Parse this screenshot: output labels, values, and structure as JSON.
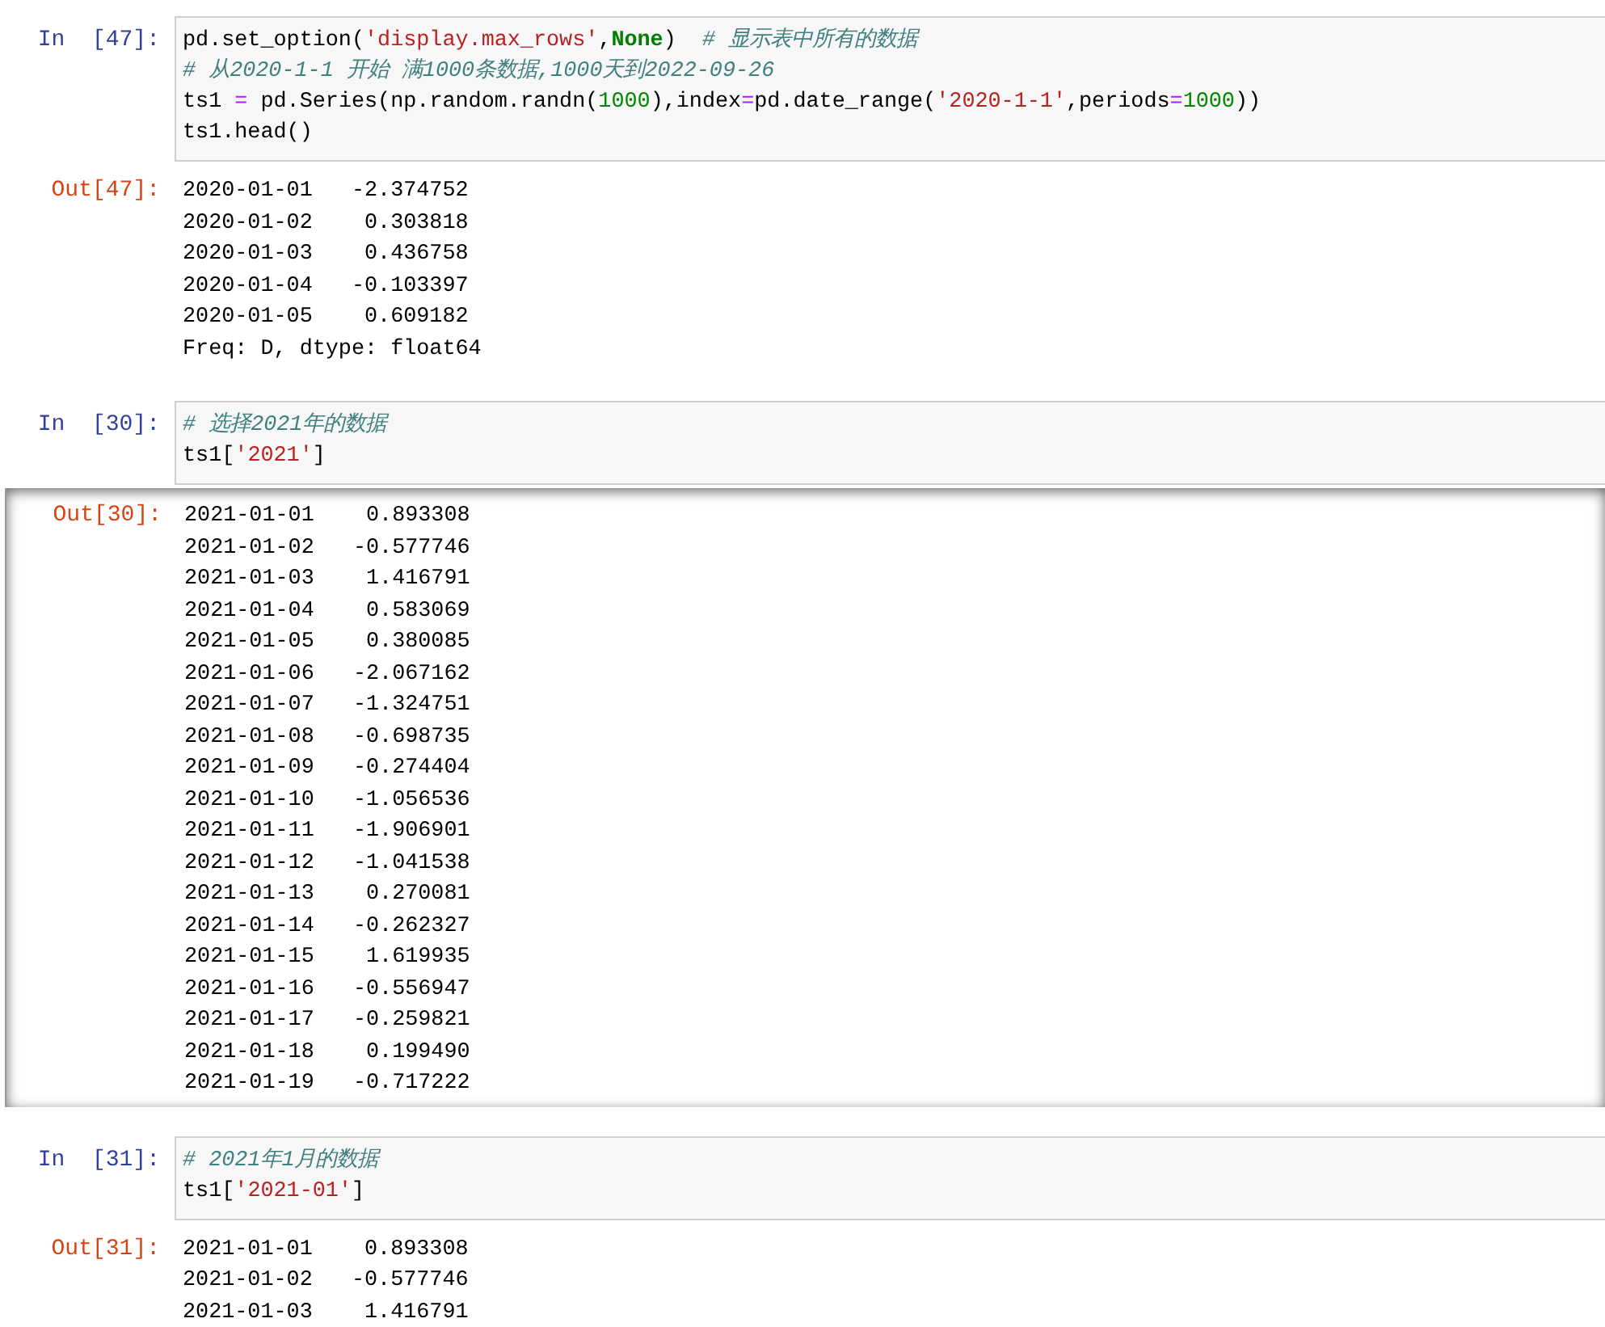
{
  "cells": [
    {
      "input": {
        "prompt": "In  [47]:",
        "lines": [
          [
            {
              "kind": "plain",
              "text": "pd.set_option("
            },
            {
              "kind": "string",
              "text": "'display.max_rows'"
            },
            {
              "kind": "plain",
              "text": ","
            },
            {
              "kind": "keyword",
              "text": "None"
            },
            {
              "kind": "plain",
              "text": ")  "
            },
            {
              "kind": "comment",
              "text": "# 显示表中所有的数据"
            }
          ],
          [
            {
              "kind": "comment",
              "text": "# 从2020-1-1 开始 满1000条数据,1000天到2022-09-26"
            }
          ],
          [
            {
              "kind": "plain",
              "text": "ts1 "
            },
            {
              "kind": "operator",
              "text": "="
            },
            {
              "kind": "plain",
              "text": " pd.Series(np.random.randn("
            },
            {
              "kind": "number",
              "text": "1000"
            },
            {
              "kind": "plain",
              "text": "),index"
            },
            {
              "kind": "operator",
              "text": "="
            },
            {
              "kind": "plain",
              "text": "pd.date_range("
            },
            {
              "kind": "string",
              "text": "'2020-1-1'"
            },
            {
              "kind": "plain",
              "text": ",periods"
            },
            {
              "kind": "operator",
              "text": "="
            },
            {
              "kind": "number",
              "text": "1000"
            },
            {
              "kind": "plain",
              "text": "))"
            }
          ],
          [
            {
              "kind": "plain",
              "text": "ts1.head()"
            }
          ]
        ]
      },
      "output": {
        "prompt": "Out[47]:",
        "scrolled": false,
        "lines": [
          "2020-01-01   -2.374752",
          "2020-01-02    0.303818",
          "2020-01-03    0.436758",
          "2020-01-04   -0.103397",
          "2020-01-05    0.609182",
          "Freq: D, dtype: float64"
        ]
      }
    },
    {
      "input": {
        "prompt": "In  [30]:",
        "lines": [
          [
            {
              "kind": "comment",
              "text": "# 选择2021年的数据"
            }
          ],
          [
            {
              "kind": "plain",
              "text": "ts1["
            },
            {
              "kind": "string",
              "text": "'2021'"
            },
            {
              "kind": "plain",
              "text": "]"
            }
          ]
        ]
      },
      "output": {
        "prompt": "Out[30]:",
        "scrolled": true,
        "lines": [
          "2021-01-01    0.893308",
          "2021-01-02   -0.577746",
          "2021-01-03    1.416791",
          "2021-01-04    0.583069",
          "2021-01-05    0.380085",
          "2021-01-06   -2.067162",
          "2021-01-07   -1.324751",
          "2021-01-08   -0.698735",
          "2021-01-09   -0.274404",
          "2021-01-10   -1.056536",
          "2021-01-11   -1.906901",
          "2021-01-12   -1.041538",
          "2021-01-13    0.270081",
          "2021-01-14   -0.262327",
          "2021-01-15    1.619935",
          "2021-01-16   -0.556947",
          "2021-01-17   -0.259821",
          "2021-01-18    0.199490",
          "2021-01-19   -0.717222"
        ]
      }
    },
    {
      "input": {
        "prompt": "In  [31]:",
        "lines": [
          [
            {
              "kind": "comment",
              "text": "# 2021年1月的数据"
            }
          ],
          [
            {
              "kind": "plain",
              "text": "ts1["
            },
            {
              "kind": "string",
              "text": "'2021-01'"
            },
            {
              "kind": "plain",
              "text": "]"
            }
          ]
        ]
      },
      "output": {
        "prompt": "Out[31]:",
        "scrolled": false,
        "lines": [
          "2021-01-01    0.893308",
          "2021-01-02   -0.577746",
          "2021-01-03    1.416791"
        ]
      }
    }
  ]
}
